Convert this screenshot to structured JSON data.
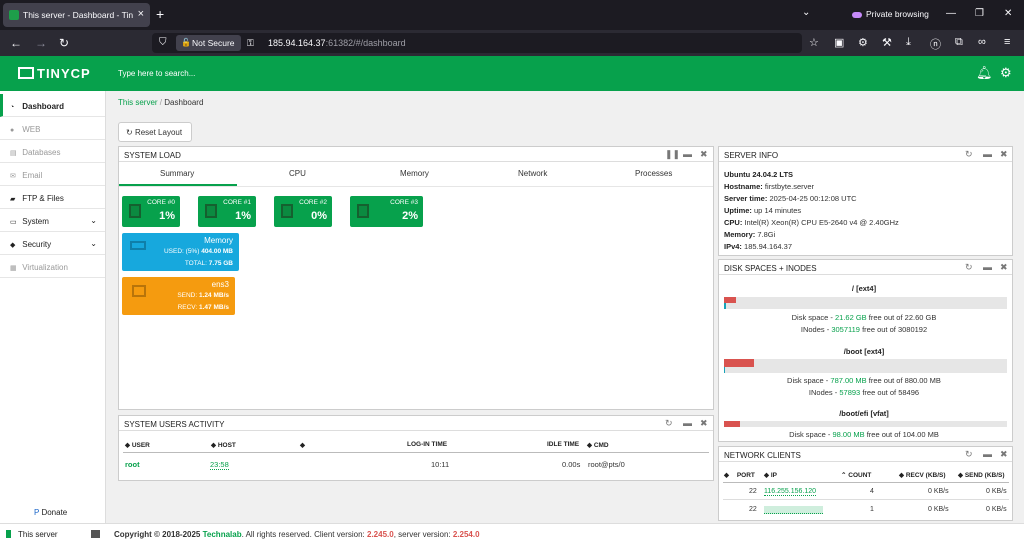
{
  "browser": {
    "tab_title": "This server - Dashboard - TinyCP",
    "private_label": "Private browsing",
    "not_secure": "Not Secure",
    "url_host": "185.94.164.37",
    "url_rest": ":61382/#/dashboard"
  },
  "header": {
    "logo_text": "TINYCP",
    "search_placeholder": "Type here to search..."
  },
  "sidebar": {
    "items": [
      {
        "label": "Dashboard"
      },
      {
        "label": "WEB"
      },
      {
        "label": "Databases"
      },
      {
        "label": "Email"
      },
      {
        "label": "FTP & Files"
      },
      {
        "label": "System"
      },
      {
        "label": "Security"
      },
      {
        "label": "Virtualization"
      }
    ],
    "donate": "Donate",
    "this_server": "This server"
  },
  "breadcrumb": {
    "root": "This server",
    "sep": "/",
    "current": "Dashboard"
  },
  "reset_layout": "Reset Layout",
  "system_load": {
    "title": "SYSTEM LOAD",
    "tabs": [
      "Summary",
      "CPU",
      "Memory",
      "Network",
      "Processes"
    ],
    "cores": [
      {
        "name": "CORE #0",
        "value": "1%"
      },
      {
        "name": "CORE #1",
        "value": "1%"
      },
      {
        "name": "CORE #2",
        "value": "0%"
      },
      {
        "name": "CORE #3",
        "value": "2%"
      }
    ],
    "memory": {
      "title": "Memory",
      "used_label": "USED: (5%)",
      "used_value": "404.00 MB",
      "total_label": "TOTAL:",
      "total_value": "7.75 GB"
    },
    "network": {
      "title": "ens3",
      "send_label": "SEND:",
      "send_value": "1.24 MB/s",
      "recv_label": "RECV:",
      "recv_value": "1.47 MB/s"
    }
  },
  "users": {
    "title": "SYSTEM USERS ACTIVITY",
    "headers": [
      "USER",
      "HOST",
      "",
      "LOG-IN TIME",
      "IDLE TIME",
      "CMD"
    ],
    "rows": [
      {
        "user": "root",
        "host": "23:58",
        "login": "10:11",
        "idle": "0.00s",
        "cmd": "root@pts/0"
      }
    ]
  },
  "server_info": {
    "title": "SERVER INFO",
    "os": "Ubuntu 24.04.2 LTS",
    "hostname_label": "Hostname:",
    "hostname": "firstbyte.server",
    "time_label": "Server time:",
    "time": "2025-04-25 00:12:08 UTC",
    "uptime_label": "Uptime:",
    "uptime": "up 14 minutes",
    "cpu_label": "CPU:",
    "cpu": "Intel(R) Xeon(R) CPU E5-2640 v4 @ 2.40GHz",
    "memory_label": "Memory:",
    "memory": "7.8Gi",
    "ipv4_label": "IPv4:",
    "ipv4": "185.94.164.37"
  },
  "disks": {
    "title": "DISK SPACES + INODES",
    "items": [
      {
        "name": "/ [ext4]",
        "disk_used_fraction": 0.043,
        "inode_used_fraction": 0.007,
        "free": "21.62 GB",
        "total": "22.60 GB",
        "inodes_free": "3057119",
        "inodes_total": "3080192"
      },
      {
        "name": "/boot [ext4]",
        "disk_used_fraction": 0.106,
        "inode_used_fraction": 0.005,
        "free": "787.00 MB",
        "total": "880.00 MB",
        "inodes_free": "57893",
        "inodes_total": "58496"
      },
      {
        "name": "/boot/efi [vfat]",
        "disk_used_fraction": 0.058,
        "free": "98.00 MB",
        "total": "104.00 MB"
      }
    ],
    "disk_label": "Disk space -",
    "inodes_label": "INodes -",
    "free_out_of": "free out of"
  },
  "network_clients": {
    "title": "NETWORK CLIENTS",
    "headers": [
      "PORT",
      "IP",
      "COUNT",
      "RECV (KB/S)",
      "SEND (KB/S)"
    ],
    "rows": [
      {
        "port": "22",
        "ip": "116.255.156.120",
        "count": "4",
        "recv": "0 KB/s",
        "send": "0 KB/s"
      },
      {
        "port": "22",
        "ip": "",
        "count": "1",
        "recv": "0 KB/s",
        "send": "0 KB/s"
      }
    ]
  },
  "footer": {
    "copyright": "Copyright © 2018-2025",
    "company": "Technalab",
    "rights": ". All rights reserved. Client version:",
    "client_version": "2.245.0",
    "server_label": ", server version:",
    "server_version": "2.254.0"
  }
}
